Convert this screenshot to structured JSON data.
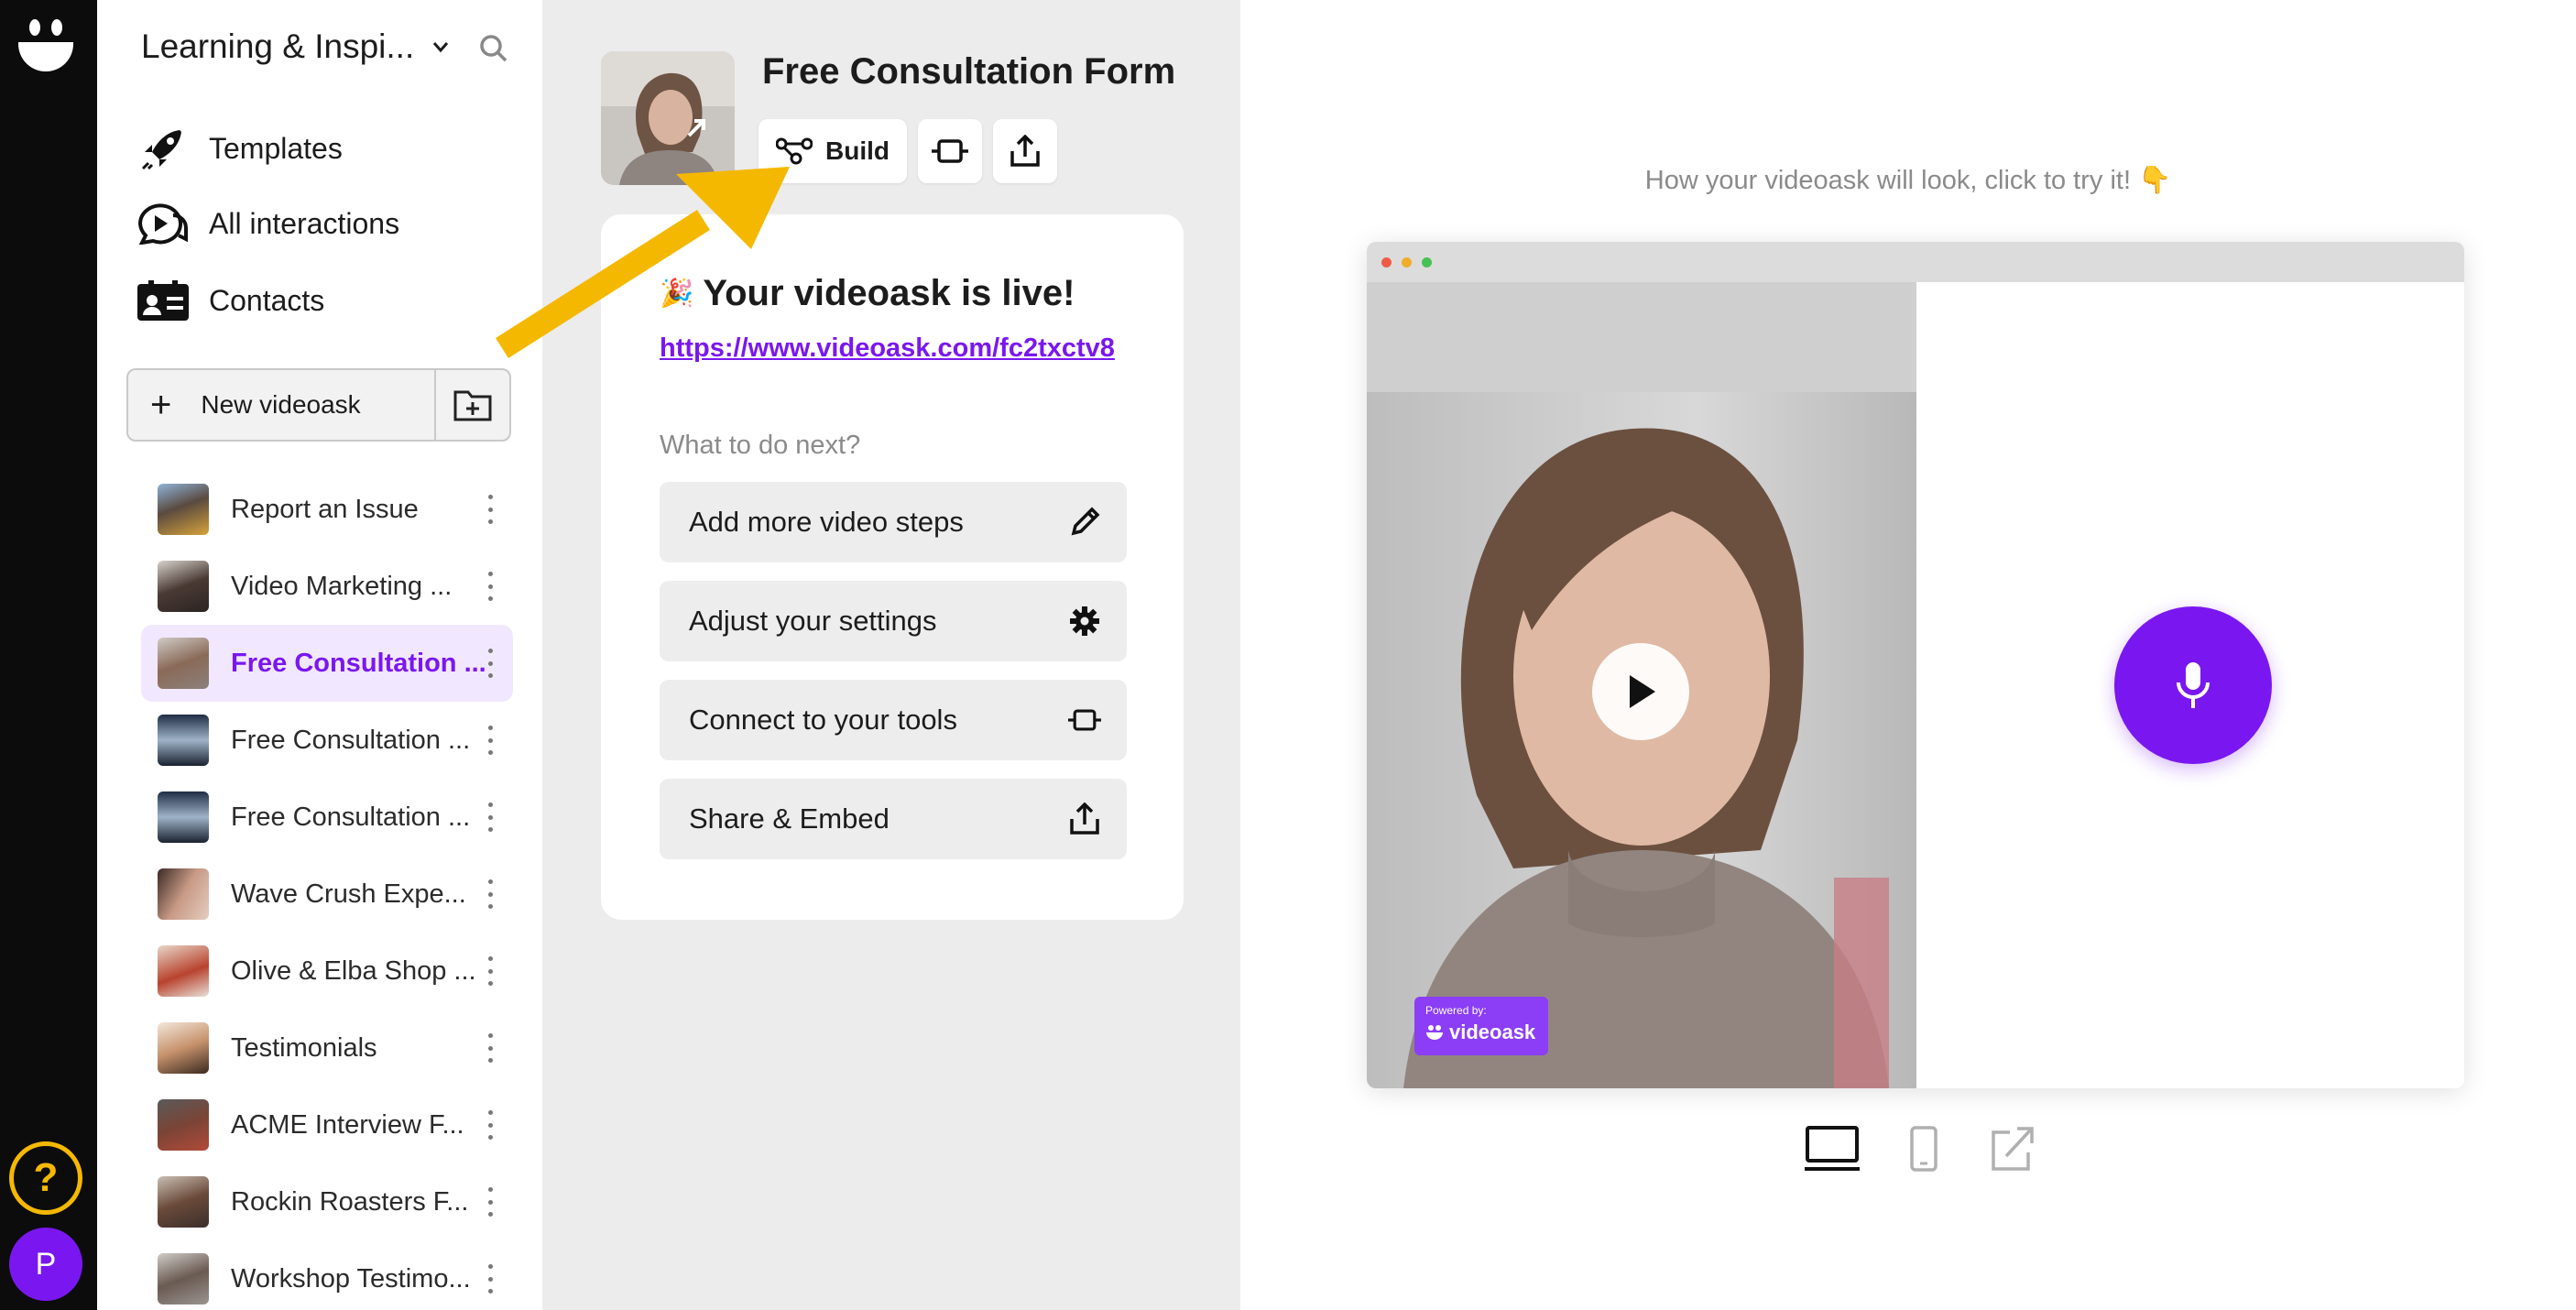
{
  "workspace": {
    "title": "Learning & Inspi..."
  },
  "nav": [
    {
      "label": "Templates",
      "icon": "rocket-icon"
    },
    {
      "label": "All interactions",
      "icon": "video-chat-icon"
    },
    {
      "label": "Contacts",
      "icon": "contacts-card-icon"
    }
  ],
  "new_videoask": {
    "label": "New videoask",
    "folder_icon": "new-folder-icon"
  },
  "videoasks": [
    {
      "label": "Report an Issue",
      "active": false
    },
    {
      "label": "Video Marketing ...",
      "active": false
    },
    {
      "label": "Free Consultation ...",
      "active": true
    },
    {
      "label": "Free Consultation ...",
      "active": false
    },
    {
      "label": "Free Consultation ...",
      "active": false
    },
    {
      "label": "Wave Crush Expe...",
      "active": false
    },
    {
      "label": "Olive & Elba Shop ...",
      "active": false
    },
    {
      "label": "Testimonials",
      "active": false
    },
    {
      "label": "ACME Interview F...",
      "active": false
    },
    {
      "label": "Rockin Roasters F...",
      "active": false
    },
    {
      "label": "Workshop Testimo...",
      "active": false
    }
  ],
  "rail": {
    "help": "?",
    "avatar": "P"
  },
  "form": {
    "title": "Free Consultation Form",
    "build_label": "Build"
  },
  "card": {
    "live_title": "Your videoask is live!",
    "party_emoji": "🎉",
    "link": "https://www.videoask.com/fc2txctv8",
    "next_label": "What to do next?",
    "actions": [
      {
        "label": "Add more video steps",
        "icon": "pencil-icon"
      },
      {
        "label": "Adjust your settings",
        "icon": "gear-icon"
      },
      {
        "label": "Connect to your tools",
        "icon": "plug-icon"
      },
      {
        "label": "Share & Embed",
        "icon": "share-icon"
      }
    ]
  },
  "preview": {
    "hint": "How your videoask will look, click to try it! 👇",
    "powered_by": "Powered by:",
    "brand": "videoask"
  },
  "colors": {
    "accent": "#7a17f0",
    "arrow": "#f5b800",
    "panel": "#ececec"
  }
}
